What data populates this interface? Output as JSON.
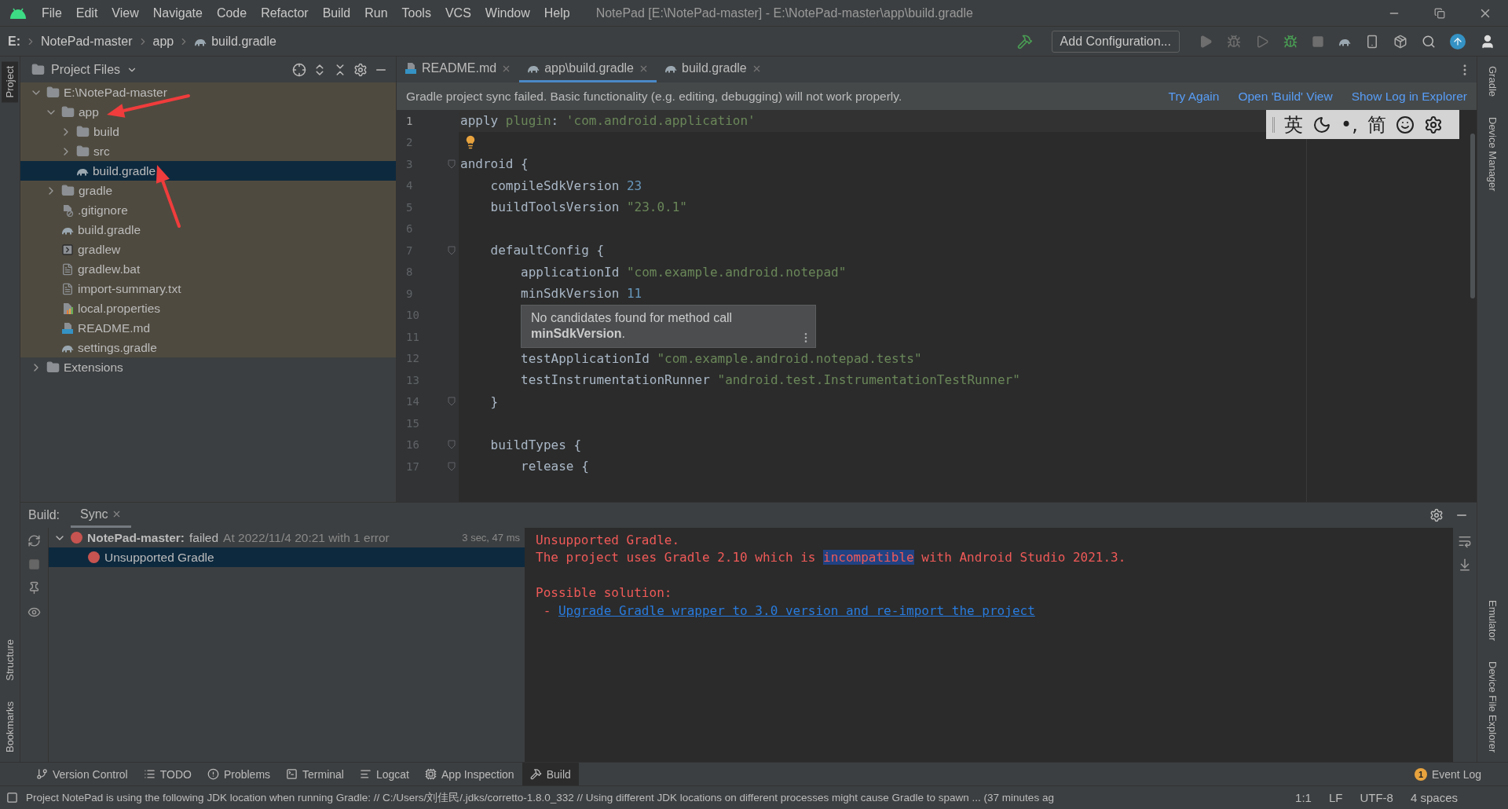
{
  "menu_bar": {
    "items": [
      "File",
      "Edit",
      "View",
      "Navigate",
      "Code",
      "Refactor",
      "Build",
      "Run",
      "Tools",
      "VCS",
      "Window",
      "Help"
    ],
    "title": "NotePad [E:\\NotePad-master] - E:\\NotePad-master\\app\\build.gradle"
  },
  "nav_bar": {
    "breadcrumbs": [
      "E:",
      "NotePad-master",
      "app",
      "build.gradle"
    ],
    "run_config": "Add Configuration..."
  },
  "left_strip": {
    "top": [
      {
        "label": "Project",
        "selected": true
      }
    ],
    "bottom": [
      {
        "label": "Structure",
        "selected": false
      },
      {
        "label": "Bookmarks",
        "selected": false
      }
    ]
  },
  "project_panel": {
    "title": "Project Files",
    "tree": [
      {
        "label": "E:\\NotePad-master",
        "kind": "folder",
        "expanded": true,
        "selected": false,
        "children": [
          {
            "label": "app",
            "kind": "folder",
            "expanded": true,
            "selected": false,
            "children": [
              {
                "label": "build",
                "kind": "folder",
                "expanded": false,
                "selected": false
              },
              {
                "label": "src",
                "kind": "folder",
                "expanded": false,
                "selected": false
              },
              {
                "label": "build.gradle",
                "kind": "gradle",
                "selected": true
              }
            ]
          },
          {
            "label": "gradle",
            "kind": "folder",
            "expanded": false,
            "selected": false
          },
          {
            "label": ".gitignore",
            "kind": "ignore",
            "selected": false
          },
          {
            "label": "build.gradle",
            "kind": "gradle",
            "selected": false
          },
          {
            "label": "gradlew",
            "kind": "shell",
            "selected": false
          },
          {
            "label": "gradlew.bat",
            "kind": "text",
            "selected": false
          },
          {
            "label": "import-summary.txt",
            "kind": "text",
            "selected": false
          },
          {
            "label": "local.properties",
            "kind": "properties",
            "selected": false
          },
          {
            "label": "README.md",
            "kind": "markdown",
            "selected": false
          },
          {
            "label": "settings.gradle",
            "kind": "gradle",
            "selected": false
          }
        ]
      },
      {
        "label": "Extensions",
        "kind": "folder",
        "expanded": false,
        "selected": false
      }
    ]
  },
  "editor": {
    "tabs": [
      {
        "label": "README.md",
        "kind": "markdown",
        "selected": false
      },
      {
        "label": "app\\build.gradle",
        "kind": "gradle",
        "selected": true
      },
      {
        "label": "build.gradle",
        "kind": "gradle",
        "selected": false
      }
    ],
    "banner": {
      "message": "Gradle project sync failed. Basic functionality (e.g. editing, debugging) will not work properly.",
      "actions": [
        "Try Again",
        "Open 'Build' View",
        "Show Log in Explorer"
      ]
    },
    "lines": [
      {
        "number": "1",
        "current": true,
        "tokens": [
          {
            "kind": "plain",
            "text": "apply "
          },
          {
            "kind": "string",
            "text": "plugin"
          },
          {
            "kind": "plain",
            "text": ": "
          },
          {
            "kind": "string",
            "text": "'com.android.application'"
          }
        ]
      },
      {
        "number": "2",
        "current": false,
        "hint": true
      },
      {
        "number": "3",
        "current": false,
        "fold": true,
        "tokens": [
          {
            "kind": "plain",
            "text": "android {"
          }
        ]
      },
      {
        "number": "4",
        "current": false,
        "tokens": [
          {
            "kind": "plain",
            "text": "    compileSdkVersion "
          },
          {
            "kind": "number",
            "text": "23"
          }
        ]
      },
      {
        "number": "5",
        "current": false,
        "tokens": [
          {
            "kind": "plain",
            "text": "    buildToolsVersion "
          },
          {
            "kind": "string",
            "text": "\"23.0.1\""
          }
        ]
      },
      {
        "number": "6",
        "current": false
      },
      {
        "number": "7",
        "current": false,
        "fold": true,
        "tokens": [
          {
            "kind": "plain",
            "text": "    defaultConfig {"
          }
        ]
      },
      {
        "number": "8",
        "current": false,
        "tokens": [
          {
            "kind": "plain",
            "text": "        applicationId "
          },
          {
            "kind": "string",
            "text": "\"com.example.android.notepad\""
          }
        ]
      },
      {
        "number": "9",
        "current": false,
        "tokens": [
          {
            "kind": "plain",
            "text": "        minSdkVersion "
          },
          {
            "kind": "number",
            "text": "11"
          }
        ]
      },
      {
        "number": "10",
        "current": false
      },
      {
        "number": "11",
        "current": false
      },
      {
        "number": "12",
        "current": false,
        "tokens": [
          {
            "kind": "plain",
            "text": "        testApplicationId "
          },
          {
            "kind": "string",
            "text": "\"com.example.android.notepad.tests\""
          }
        ]
      },
      {
        "number": "13",
        "current": false,
        "tokens": [
          {
            "kind": "plain",
            "text": "        testInstrumentationRunner "
          },
          {
            "kind": "string",
            "text": "\"android.test.InstrumentationTestRunner\""
          }
        ]
      },
      {
        "number": "14",
        "current": false,
        "fold": true,
        "tokens": [
          {
            "kind": "plain",
            "text": "    }"
          }
        ]
      },
      {
        "number": "15",
        "current": false
      },
      {
        "number": "16",
        "current": false,
        "fold": true,
        "tokens": [
          {
            "kind": "plain",
            "text": "    buildTypes {"
          }
        ]
      },
      {
        "number": "17",
        "current": false,
        "fold": true,
        "tokens": [
          {
            "kind": "plain",
            "text": "        release {"
          }
        ]
      }
    ],
    "tooltip": "No candidates found for method call **minSdkVersion**.",
    "ime_bar": {
      "language": "英",
      "punctuation": "•,",
      "script": "简"
    }
  },
  "right_strip": {
    "top": [
      "Gradle",
      "Device Manager"
    ],
    "bottom": [
      "Emulator",
      "Device File Explorer"
    ]
  },
  "build_panel": {
    "label": "Build:",
    "tabs": [
      {
        "label": "Sync",
        "selected": true
      }
    ],
    "tree": [
      {
        "label": "NotePad-master:",
        "status": "failed",
        "detail": "At 2022/11/4 20:21 with 1 error",
        "time": "3 sec, 47 ms",
        "expanded": true,
        "selected": false,
        "children": [
          {
            "label": "Unsupported Gradle",
            "selected": true
          }
        ]
      }
    ],
    "console": [
      {
        "kind": "error",
        "segments": [
          {
            "text": "Unsupported Gradle.",
            "highlighted": false
          }
        ]
      },
      {
        "kind": "error",
        "segments": [
          {
            "text": "The project uses Gradle 2.10 which is ",
            "highlighted": false
          },
          {
            "text": "incompatible",
            "highlighted": true
          },
          {
            "text": " with Android Studio 2021.3.",
            "highlighted": false
          }
        ]
      },
      {
        "kind": "blank"
      },
      {
        "kind": "error",
        "segments": [
          {
            "text": "Possible solution:",
            "highlighted": false
          }
        ]
      },
      {
        "kind": "link",
        "prefix": " - ",
        "text": "Upgrade Gradle wrapper to 3.0 version and re-import the project"
      }
    ]
  },
  "tool_windows": [
    {
      "label": "Version Control",
      "selected": false
    },
    {
      "label": "TODO",
      "selected": false
    },
    {
      "label": "Problems",
      "selected": false
    },
    {
      "label": "Terminal",
      "selected": false
    },
    {
      "label": "Logcat",
      "selected": false
    },
    {
      "label": "App Inspection",
      "selected": false
    },
    {
      "label": "Build",
      "selected": true
    }
  ],
  "event_log": {
    "label": "Event Log",
    "count": "1"
  },
  "status_bar": {
    "message": "Project NotePad is using the following JDK location when running Gradle: // C:/Users/刘佳民/.jdks/corretto-1.8.0_332 // Using different JDK locations on different processes might cause Gradle to spawn ... (37 minutes ag",
    "items": [
      "1:1",
      "LF",
      "UTF-8",
      "4 spaces"
    ]
  }
}
